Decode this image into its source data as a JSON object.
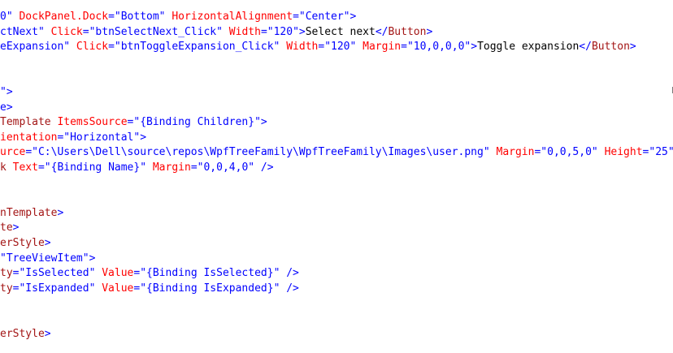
{
  "editor": {
    "lines": [
      [
        [
          "k-val",
          "0\""
        ],
        [
          "k-attr",
          " DockPanel.Dock"
        ],
        [
          "k-punct",
          "="
        ],
        [
          "k-val",
          "\"Bottom\""
        ],
        [
          "k-attr",
          " HorizontalAlignment"
        ],
        [
          "k-punct",
          "="
        ],
        [
          "k-val",
          "\"Center\""
        ],
        [
          "k-punct",
          ">"
        ]
      ],
      [
        [
          "k-val",
          "ctNext\""
        ],
        [
          "k-attr",
          " Click"
        ],
        [
          "k-punct",
          "="
        ],
        [
          "k-val",
          "\"btnSelectNext_Click\""
        ],
        [
          "k-attr",
          " Width"
        ],
        [
          "k-punct",
          "="
        ],
        [
          "k-val",
          "\"120\""
        ],
        [
          "k-punct",
          ">"
        ],
        [
          "k-text",
          "Select next"
        ],
        [
          "k-punct",
          "</"
        ],
        [
          "k-tag",
          "Button"
        ],
        [
          "k-punct",
          ">"
        ]
      ],
      [
        [
          "k-val",
          "eExpansion\""
        ],
        [
          "k-attr",
          " Click"
        ],
        [
          "k-punct",
          "="
        ],
        [
          "k-val",
          "\"btnToggleExpansion_Click\""
        ],
        [
          "k-attr",
          " Width"
        ],
        [
          "k-punct",
          "="
        ],
        [
          "k-val",
          "\"120\""
        ],
        [
          "k-attr",
          " Margin"
        ],
        [
          "k-punct",
          "="
        ],
        [
          "k-val",
          "\"10,0,0,0\""
        ],
        [
          "k-punct",
          ">"
        ],
        [
          "k-text",
          "Toggle expansion"
        ],
        [
          "k-punct",
          "</"
        ],
        [
          "k-tag",
          "Button"
        ],
        [
          "k-punct",
          ">"
        ]
      ],
      [],
      [],
      [
        [
          "k-val",
          "\""
        ],
        [
          "k-punct",
          ">"
        ]
      ],
      [
        [
          "k-punct",
          "e>"
        ]
      ],
      [
        [
          "k-tag",
          "Template"
        ],
        [
          "k-attr",
          " ItemsSource"
        ],
        [
          "k-punct",
          "="
        ],
        [
          "k-val",
          "\"{Binding Children}\""
        ],
        [
          "k-punct",
          ">"
        ]
      ],
      [
        [
          "k-attr",
          "ientation"
        ],
        [
          "k-punct",
          "="
        ],
        [
          "k-val",
          "\"Horizontal\""
        ],
        [
          "k-punct",
          ">"
        ]
      ],
      [
        [
          "k-attr",
          "urce"
        ],
        [
          "k-punct",
          "="
        ],
        [
          "k-val",
          "\"C:\\Users\\Dell\\source\\repos\\WpfTreeFamily\\WpfTreeFamily\\Images\\user.png\""
        ],
        [
          "k-attr",
          " Margin"
        ],
        [
          "k-punct",
          "="
        ],
        [
          "k-val",
          "\"0,0,5,0\""
        ],
        [
          "k-attr",
          " Height"
        ],
        [
          "k-punct",
          "="
        ],
        [
          "k-val",
          "\"25\""
        ]
      ],
      [
        [
          "k-tag",
          "k"
        ],
        [
          "k-attr",
          " Text"
        ],
        [
          "k-punct",
          "="
        ],
        [
          "k-val",
          "\"{Binding Name}\""
        ],
        [
          "k-attr",
          " Margin"
        ],
        [
          "k-punct",
          "="
        ],
        [
          "k-val",
          "\"0,0,4,0\""
        ],
        [
          "k-punct",
          " />"
        ]
      ],
      [],
      [],
      [
        [
          "k-tag",
          "nTemplate"
        ],
        [
          "k-punct",
          ">"
        ]
      ],
      [
        [
          "k-tag",
          "te"
        ],
        [
          "k-punct",
          ">"
        ]
      ],
      [
        [
          "k-tag",
          "erStyle"
        ],
        [
          "k-punct",
          ">"
        ]
      ],
      [
        [
          "k-val",
          "\"TreeViewItem\""
        ],
        [
          "k-punct",
          ">"
        ]
      ],
      [
        [
          "k-tag",
          "ty"
        ],
        [
          "k-punct",
          "="
        ],
        [
          "k-val",
          "\"IsSelected\""
        ],
        [
          "k-attr",
          " Value"
        ],
        [
          "k-punct",
          "="
        ],
        [
          "k-val",
          "\"{Binding IsSelected}\""
        ],
        [
          "k-punct",
          " />"
        ]
      ],
      [
        [
          "k-tag",
          "ty"
        ],
        [
          "k-punct",
          "="
        ],
        [
          "k-val",
          "\"IsExpanded\""
        ],
        [
          "k-attr",
          " Value"
        ],
        [
          "k-punct",
          "="
        ],
        [
          "k-val",
          "\"{Binding IsExpanded}\""
        ],
        [
          "k-punct",
          " />"
        ]
      ],
      [],
      [],
      [
        [
          "k-tag",
          "erStyle"
        ],
        [
          "k-punct",
          ">"
        ]
      ]
    ]
  }
}
